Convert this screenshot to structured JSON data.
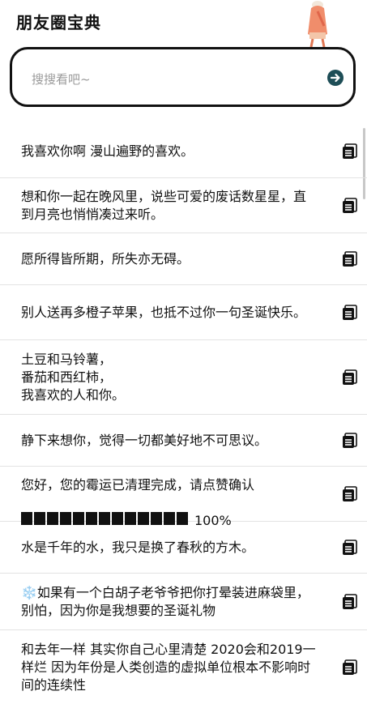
{
  "header": {
    "title": "朋友圈宝典"
  },
  "search": {
    "placeholder": "搜搜看吧~"
  },
  "items": [
    {
      "text": "我喜欢你啊 漫山遍野的喜欢。"
    },
    {
      "text": "想和你一起在晚风里，说些可爱的废话数星星，直到月亮也悄悄凑过来听。"
    },
    {
      "text": "愿所得皆所期，所失亦无碍。"
    },
    {
      "text": "别人送再多橙子苹果，也抵不过你一句圣诞快乐。"
    },
    {
      "text": "土豆和马铃薯，\n番茄和西红柿，\n我喜欢的人和你。"
    },
    {
      "text": "静下来想你，觉得一切都美好地不可思议。"
    },
    {
      "text": "您好，您的霉运已清理完成，请点赞确认",
      "progress_text": "100%",
      "progress_blocks": 13,
      "progress_value": 1.0
    },
    {
      "text": "水是千年的水，我只是换了春秋的方木。"
    },
    {
      "text": "❄️如果有一个白胡子老爷爷把你打晕装进麻袋里，别怕，因为你是我想要的圣诞礼物"
    },
    {
      "text": "和去年一样 其实你自己心里清楚 2020会和2019一样烂 因为年份是人类创造的虚拟单位根本不影响时间的连续性"
    }
  ],
  "colors": {
    "accent": "#1e4e57",
    "text": "#111111",
    "divider": "#e3e3e3"
  },
  "icons": {
    "search_go": "arrow-right-circle-icon",
    "copy": "copy-icon"
  }
}
